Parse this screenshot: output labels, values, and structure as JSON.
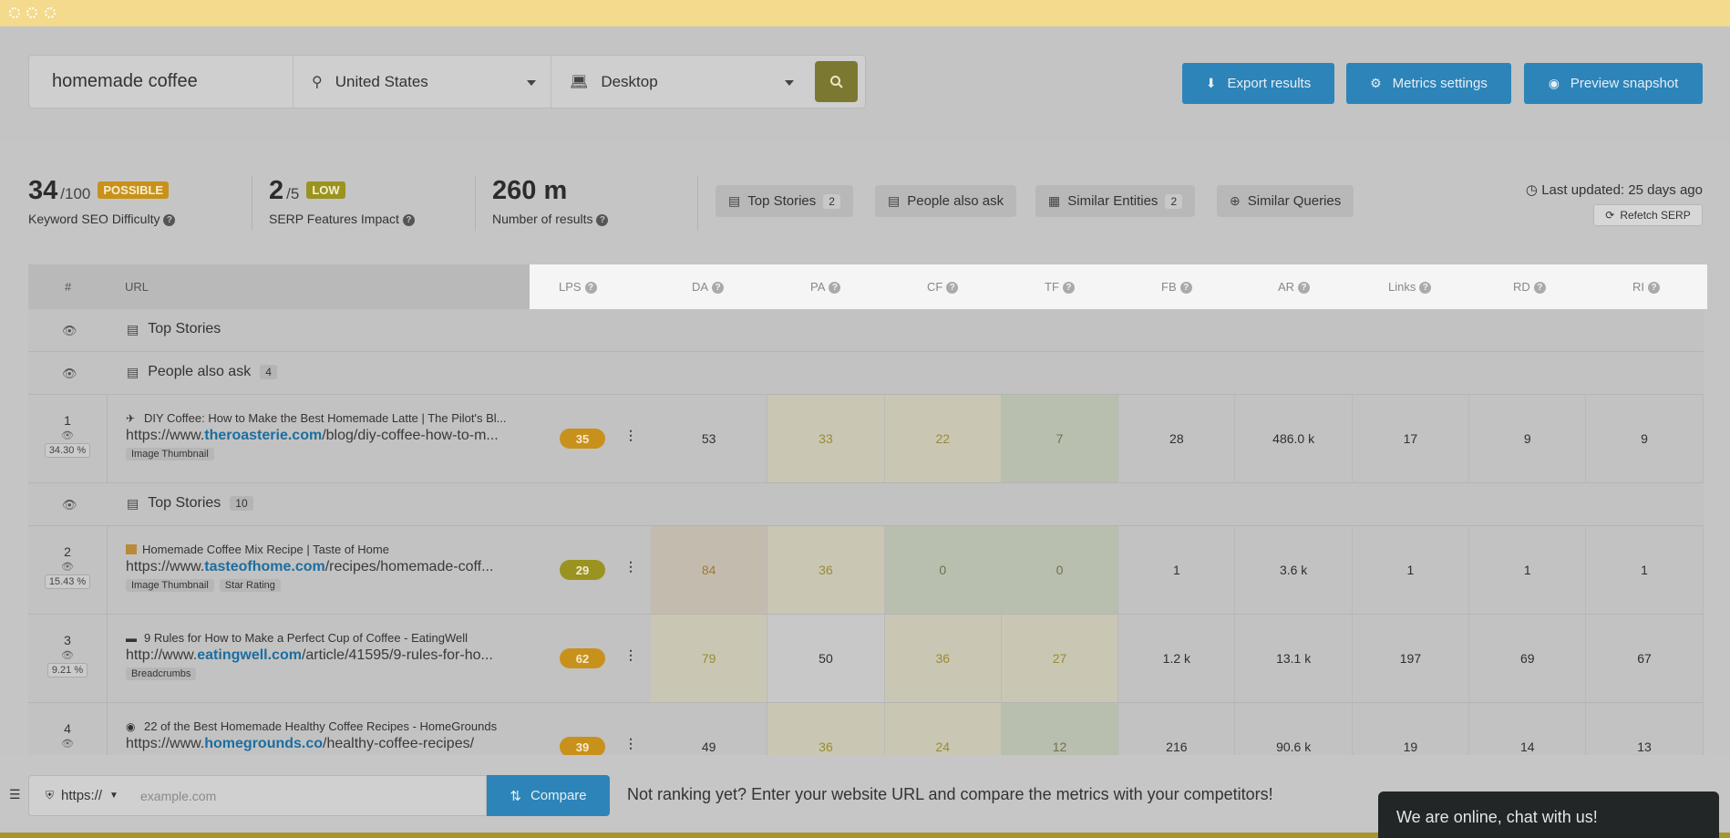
{
  "search": {
    "keyword": "homemade coffee",
    "location": "United States",
    "device": "Desktop"
  },
  "actions": {
    "export": "Export results",
    "metrics": "Metrics settings",
    "preview": "Preview snapshot"
  },
  "stats": {
    "difficulty": {
      "value": "34",
      "of": "/100",
      "badge": "POSSIBLE",
      "label": "Keyword SEO Difficulty"
    },
    "serp": {
      "value": "2",
      "of": "/5",
      "badge": "LOW",
      "label": "SERP Features Impact"
    },
    "results": {
      "value": "260 m",
      "label": "Number of results"
    }
  },
  "features": [
    {
      "label": "Top Stories",
      "count": "2"
    },
    {
      "label": "People also ask",
      "count": ""
    },
    {
      "label": "Similar Entities",
      "count": "2"
    },
    {
      "label": "Similar Queries",
      "count": ""
    }
  ],
  "updated": "Last updated: 25 days ago",
  "refetch": "Refetch SERP",
  "table": {
    "headers": {
      "rank": "#",
      "url": "URL"
    },
    "metric_headers": [
      "LPS",
      "DA",
      "PA",
      "CF",
      "TF",
      "FB",
      "AR",
      "Links",
      "RD",
      "RI"
    ],
    "group_top_stories": "Top Stories",
    "group_people": "People also ask",
    "group_people_count": "4",
    "group_top_stories2": "Top Stories",
    "group_top_stories2_count": "10",
    "rows": [
      {
        "rank": "1",
        "pct": "34.30 %",
        "title": "DIY Coffee: How to Make the Best Homemade Latte | The Pilot's Bl...",
        "url_pre": "https://www.",
        "url_domain": "theroasterie.com",
        "url_post": "/blog/diy-coffee-how-to-m...",
        "tags": [
          "Image Thumbnail"
        ],
        "lps": "35",
        "metrics": [
          "53",
          "33",
          "22",
          "7",
          "28",
          "486.0 k",
          "17",
          "9",
          "9"
        ]
      },
      {
        "rank": "2",
        "pct": "15.43 %",
        "title": "Homemade Coffee Mix Recipe | Taste of Home",
        "url_pre": "https://www.",
        "url_domain": "tasteofhome.com",
        "url_post": "/recipes/homemade-coff...",
        "tags": [
          "Image Thumbnail",
          "Star Rating"
        ],
        "lps": "29",
        "metrics": [
          "84",
          "36",
          "0",
          "0",
          "1",
          "3.6 k",
          "1",
          "1",
          "1"
        ]
      },
      {
        "rank": "3",
        "pct": "9.21 %",
        "title": "9 Rules for How to Make a Perfect Cup of Coffee - EatingWell",
        "url_pre": "http://www.",
        "url_domain": "eatingwell.com",
        "url_post": "/article/41595/9-rules-for-ho...",
        "tags": [
          "Breadcrumbs"
        ],
        "lps": "62",
        "metrics": [
          "79",
          "50",
          "36",
          "27",
          "1.2 k",
          "13.1 k",
          "197",
          "69",
          "67"
        ]
      },
      {
        "rank": "4",
        "pct": "",
        "title": "22 of the Best Homemade Healthy Coffee Recipes - HomeGrounds",
        "url_pre": "https://www.",
        "url_domain": "homegrounds.co",
        "url_post": "/healthy-coffee-recipes/",
        "tags": [],
        "lps": "39",
        "metrics": [
          "49",
          "36",
          "24",
          "12",
          "216",
          "90.6 k",
          "19",
          "14",
          "13"
        ]
      }
    ]
  },
  "bottom": {
    "protocol": "https://",
    "placeholder": "example.com",
    "compare": "Compare",
    "message": "Not ranking yet? Enter your website URL and compare the metrics with your competitors!"
  },
  "chat": "We are online, chat with us!",
  "colors": {
    "accent_blue": "#2d84b9",
    "badge_orange": "#c8911b",
    "badge_olive": "#9a9320",
    "search_btn": "#7b7831"
  }
}
